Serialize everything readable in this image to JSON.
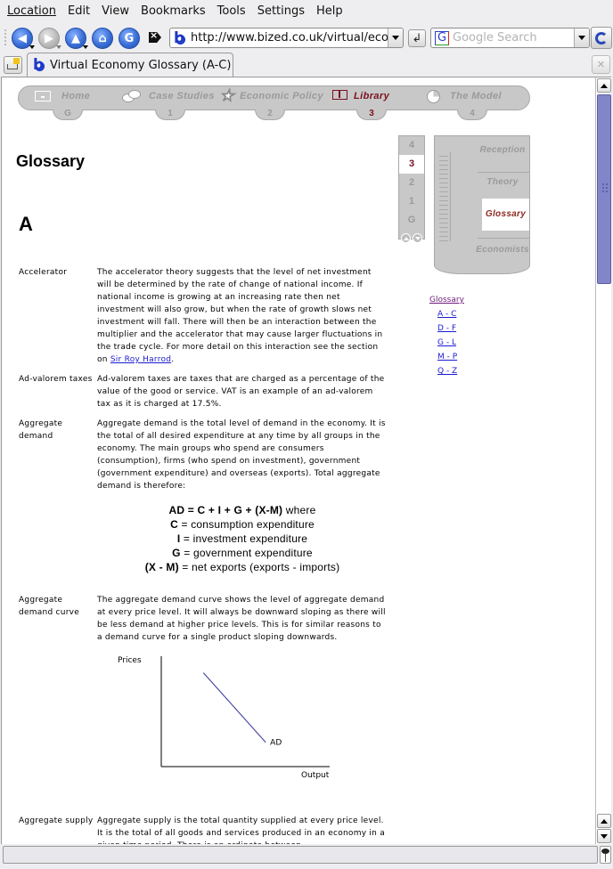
{
  "menubar": {
    "items": [
      "Location",
      "Edit",
      "View",
      "Bookmarks",
      "Tools",
      "Settings",
      "Help"
    ]
  },
  "toolbar": {
    "url": "http://www.bized.co.uk/virtual/economy/library/glossary/glossac.htm",
    "search_placeholder": "Google Search",
    "icons": [
      "back-icon",
      "forward-icon",
      "up-icon",
      "home-icon",
      "reload-icon",
      "clear-location-icon",
      "go-icon",
      "google-icon",
      "kde-icon"
    ]
  },
  "tabs": [
    {
      "title": "Virtual Economy Glossary (A-C)",
      "active": true
    }
  ],
  "site_nav": {
    "tabs": [
      {
        "label": "Home",
        "floor": "G",
        "icon": "briefcase-icon",
        "active": false
      },
      {
        "label": "Case Studies",
        "floor": "1",
        "icon": "speech-bubbles-icon",
        "active": false
      },
      {
        "label": "Economic Policy",
        "floor": "2",
        "icon": "star-icon",
        "active": false
      },
      {
        "label": "Library",
        "floor": "3",
        "icon": "book-icon",
        "active": true
      },
      {
        "label": "The Model",
        "floor": "4",
        "icon": "pie-chart-icon",
        "active": false
      }
    ],
    "active_color": "#7a1020"
  },
  "floor_selector": {
    "floors": [
      "4",
      "3",
      "2",
      "1",
      "G"
    ],
    "active": "3"
  },
  "building_map": {
    "rooms": [
      {
        "label": "Reception",
        "active": false
      },
      {
        "label": "Theory",
        "active": false
      },
      {
        "label": "Glossary",
        "active": true
      },
      {
        "label": "Economists",
        "active": false
      }
    ]
  },
  "side_links": {
    "glossary": "Glossary",
    "ranges": [
      "A - C",
      "D - F",
      "G - L",
      "M - P",
      "Q - Z"
    ]
  },
  "page": {
    "title": "Glossary",
    "letter": "A"
  },
  "entries": [
    {
      "term": "Accelerator",
      "definition": "The accelerator theory suggests that the level of net investment will be determined by the rate of change of national income. If national income is growing at an increasing rate then net investment will also grow, but when the rate of growth slows net investment will fall. There will then be an interaction between the multiplier and the accelerator that may cause larger fluctuations in the trade cycle. For more detail on this interaction see the section on ",
      "link": "Sir Roy Harrod",
      "after_link": "."
    },
    {
      "term": "Ad-valorem taxes",
      "definition": "Ad-valorem taxes are taxes that are charged as a percentage of the value of the good or service. VAT is an example of an ad-valorem tax as it is charged at 17.5%."
    },
    {
      "term": "Aggregate demand",
      "definition": "Aggregate demand is the total level of demand in the economy. It is the total of all desired expenditure at any time by all groups in the economy. The main groups who spend are consumers (consumption), firms (who spend on investment), government (government expenditure) and overseas (exports). Total aggregate demand is therefore:"
    },
    {
      "term": "Aggregate demand curve",
      "definition": "The aggregate demand curve shows the level of aggregate demand at every price level. It will always be downward sloping as there will be less demand at higher price levels. This is for similar reasons to a demand curve for a single product sloping downwards."
    },
    {
      "term": "Aggregate supply",
      "definition": "Aggregate supply is the total quantity supplied at every price level. It is the total of all goods and services produced in an economy in a given time period. There is an ordinate between ..."
    }
  ],
  "formula": {
    "lines": [
      {
        "bold": "AD = C + I + G + (X-M)",
        "rest": " where"
      },
      {
        "bold": "C",
        "rest": " = consumption expenditure"
      },
      {
        "bold": "I",
        "rest": " = investment expenditure"
      },
      {
        "bold": "G",
        "rest": " = government expenditure"
      },
      {
        "bold": "(X - M)",
        "rest": " = net exports (exports - imports)"
      }
    ]
  },
  "chart_data": {
    "type": "line",
    "title": "",
    "xlabel": "Output",
    "ylabel": "Prices",
    "series": [
      {
        "name": "AD",
        "x": [
          0.25,
          0.62
        ],
        "y": [
          0.85,
          0.22
        ],
        "color": "#4a4aa8"
      }
    ],
    "xlim": [
      0,
      1
    ],
    "ylim": [
      0,
      1
    ],
    "grid": false,
    "annotations": [
      {
        "text": "AD",
        "at": "end-of-line"
      }
    ]
  }
}
